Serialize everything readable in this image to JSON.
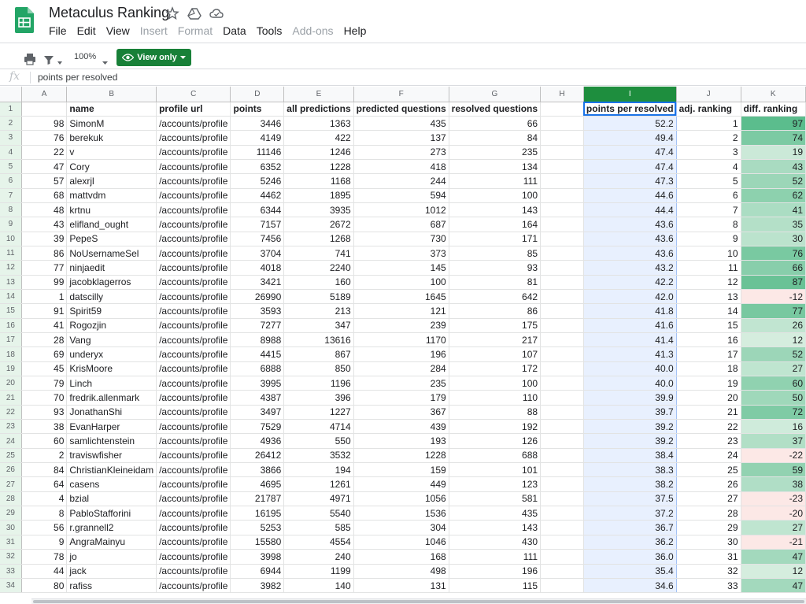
{
  "title": "Metaculus Ranking",
  "menu": [
    {
      "label": "File",
      "disabled": false
    },
    {
      "label": "Edit",
      "disabled": false
    },
    {
      "label": "View",
      "disabled": false
    },
    {
      "label": "Insert",
      "disabled": true
    },
    {
      "label": "Format",
      "disabled": true
    },
    {
      "label": "Data",
      "disabled": false
    },
    {
      "label": "Tools",
      "disabled": false
    },
    {
      "label": "Add-ons",
      "disabled": true
    },
    {
      "label": "Help",
      "disabled": false
    }
  ],
  "toolbar": {
    "zoom": "100%",
    "view_only_label": "View only"
  },
  "formula_bar": {
    "fx_label": "fx",
    "content": "points per resolved"
  },
  "colors": {
    "brand_green": "#188038",
    "selected_col": "#1e8e3e",
    "selected_fill": "#e8f0fe",
    "selection_border": "#1a73e8"
  },
  "columns": [
    "A",
    "B",
    "C",
    "D",
    "E",
    "F",
    "G",
    "H",
    "I",
    "J",
    "K"
  ],
  "selected_column": "I",
  "header_row": {
    "row": "1",
    "cells": [
      "",
      "name",
      "profile url",
      "points",
      "all predictions",
      "predicted questions",
      "resolved questions",
      "",
      "points per resolved",
      "adj. ranking",
      "diff. ranking"
    ]
  },
  "rows": [
    {
      "row": "2",
      "a": "98",
      "name": "SimonM",
      "url": "/accounts/profile",
      "points": "3446",
      "all": "1363",
      "pred": "435",
      "res": "66",
      "h": "",
      "ppr": "52.2",
      "adj": "1",
      "diff": "97"
    },
    {
      "row": "3",
      "a": "76",
      "name": "berekuk",
      "url": "/accounts/profile",
      "points": "4149",
      "all": "422",
      "pred": "137",
      "res": "84",
      "h": "",
      "ppr": "49.4",
      "adj": "2",
      "diff": "74"
    },
    {
      "row": "4",
      "a": "22",
      "name": "v",
      "url": "/accounts/profile",
      "points": "11146",
      "all": "1246",
      "pred": "273",
      "res": "235",
      "h": "",
      "ppr": "47.4",
      "adj": "3",
      "diff": "19"
    },
    {
      "row": "5",
      "a": "47",
      "name": "Cory",
      "url": "/accounts/profile",
      "points": "6352",
      "all": "1228",
      "pred": "418",
      "res": "134",
      "h": "",
      "ppr": "47.4",
      "adj": "4",
      "diff": "43"
    },
    {
      "row": "6",
      "a": "57",
      "name": "alexrjl",
      "url": "/accounts/profile",
      "points": "5246",
      "all": "1168",
      "pred": "244",
      "res": "111",
      "h": "",
      "ppr": "47.3",
      "adj": "5",
      "diff": "52"
    },
    {
      "row": "7",
      "a": "68",
      "name": "mattvdm",
      "url": "/accounts/profile",
      "points": "4462",
      "all": "1895",
      "pred": "594",
      "res": "100",
      "h": "",
      "ppr": "44.6",
      "adj": "6",
      "diff": "62"
    },
    {
      "row": "8",
      "a": "48",
      "name": "krtnu",
      "url": "/accounts/profile",
      "points": "6344",
      "all": "3935",
      "pred": "1012",
      "res": "143",
      "h": "",
      "ppr": "44.4",
      "adj": "7",
      "diff": "41"
    },
    {
      "row": "9",
      "a": "43",
      "name": "elifland_ought",
      "url": "/accounts/profile",
      "points": "7157",
      "all": "2672",
      "pred": "687",
      "res": "164",
      "h": "",
      "ppr": "43.6",
      "adj": "8",
      "diff": "35"
    },
    {
      "row": "10",
      "a": "39",
      "name": "PepeS",
      "url": "/accounts/profile",
      "points": "7456",
      "all": "1268",
      "pred": "730",
      "res": "171",
      "h": "",
      "ppr": "43.6",
      "adj": "9",
      "diff": "30"
    },
    {
      "row": "11",
      "a": "86",
      "name": "NoUsernameSel",
      "url": "/accounts/profile",
      "points": "3704",
      "all": "741",
      "pred": "373",
      "res": "85",
      "h": "",
      "ppr": "43.6",
      "adj": "10",
      "diff": "76"
    },
    {
      "row": "12",
      "a": "77",
      "name": "ninjaedit",
      "url": "/accounts/profile",
      "points": "4018",
      "all": "2240",
      "pred": "145",
      "res": "93",
      "h": "",
      "ppr": "43.2",
      "adj": "11",
      "diff": "66"
    },
    {
      "row": "13",
      "a": "99",
      "name": "jacobklagerros",
      "url": "/accounts/profile",
      "points": "3421",
      "all": "160",
      "pred": "100",
      "res": "81",
      "h": "",
      "ppr": "42.2",
      "adj": "12",
      "diff": "87"
    },
    {
      "row": "14",
      "a": "1",
      "name": "datscilly",
      "url": "/accounts/profile",
      "points": "26990",
      "all": "5189",
      "pred": "1645",
      "res": "642",
      "h": "",
      "ppr": "42.0",
      "adj": "13",
      "diff": "-12"
    },
    {
      "row": "15",
      "a": "91",
      "name": "Spirit59",
      "url": "/accounts/profile",
      "points": "3593",
      "all": "213",
      "pred": "121",
      "res": "86",
      "h": "",
      "ppr": "41.8",
      "adj": "14",
      "diff": "77"
    },
    {
      "row": "16",
      "a": "41",
      "name": "Rogozjin",
      "url": "/accounts/profile",
      "points": "7277",
      "all": "347",
      "pred": "239",
      "res": "175",
      "h": "",
      "ppr": "41.6",
      "adj": "15",
      "diff": "26"
    },
    {
      "row": "17",
      "a": "28",
      "name": "Vang",
      "url": "/accounts/profile",
      "points": "8988",
      "all": "13616",
      "pred": "1170",
      "res": "217",
      "h": "",
      "ppr": "41.4",
      "adj": "16",
      "diff": "12"
    },
    {
      "row": "18",
      "a": "69",
      "name": "underyx",
      "url": "/accounts/profile",
      "points": "4415",
      "all": "867",
      "pred": "196",
      "res": "107",
      "h": "",
      "ppr": "41.3",
      "adj": "17",
      "diff": "52"
    },
    {
      "row": "19",
      "a": "45",
      "name": "KrisMoore",
      "url": "/accounts/profile",
      "points": "6888",
      "all": "850",
      "pred": "284",
      "res": "172",
      "h": "",
      "ppr": "40.0",
      "adj": "18",
      "diff": "27"
    },
    {
      "row": "20",
      "a": "79",
      "name": "Linch",
      "url": "/accounts/profile",
      "points": "3995",
      "all": "1196",
      "pred": "235",
      "res": "100",
      "h": "",
      "ppr": "40.0",
      "adj": "19",
      "diff": "60"
    },
    {
      "row": "21",
      "a": "70",
      "name": "fredrik.allenmark",
      "url": "/accounts/profile",
      "points": "4387",
      "all": "396",
      "pred": "179",
      "res": "110",
      "h": "",
      "ppr": "39.9",
      "adj": "20",
      "diff": "50"
    },
    {
      "row": "22",
      "a": "93",
      "name": "JonathanShi",
      "url": "/accounts/profile",
      "points": "3497",
      "all": "1227",
      "pred": "367",
      "res": "88",
      "h": "",
      "ppr": "39.7",
      "adj": "21",
      "diff": "72"
    },
    {
      "row": "23",
      "a": "38",
      "name": "EvanHarper",
      "url": "/accounts/profile",
      "points": "7529",
      "all": "4714",
      "pred": "439",
      "res": "192",
      "h": "",
      "ppr": "39.2",
      "adj": "22",
      "diff": "16"
    },
    {
      "row": "24",
      "a": "60",
      "name": "samlichtenstein",
      "url": "/accounts/profile",
      "points": "4936",
      "all": "550",
      "pred": "193",
      "res": "126",
      "h": "",
      "ppr": "39.2",
      "adj": "23",
      "diff": "37"
    },
    {
      "row": "25",
      "a": "2",
      "name": "traviswfisher",
      "url": "/accounts/profile",
      "points": "26412",
      "all": "3532",
      "pred": "1228",
      "res": "688",
      "h": "",
      "ppr": "38.4",
      "adj": "24",
      "diff": "-22"
    },
    {
      "row": "26",
      "a": "84",
      "name": "ChristianKleineidam",
      "url": "/accounts/profile",
      "points": "3866",
      "all": "194",
      "pred": "159",
      "res": "101",
      "h": "",
      "ppr": "38.3",
      "adj": "25",
      "diff": "59"
    },
    {
      "row": "27",
      "a": "64",
      "name": "casens",
      "url": "/accounts/profile",
      "points": "4695",
      "all": "1261",
      "pred": "449",
      "res": "123",
      "h": "",
      "ppr": "38.2",
      "adj": "26",
      "diff": "38"
    },
    {
      "row": "28",
      "a": "4",
      "name": "bzial",
      "url": "/accounts/profile",
      "points": "21787",
      "all": "4971",
      "pred": "1056",
      "res": "581",
      "h": "",
      "ppr": "37.5",
      "adj": "27",
      "diff": "-23"
    },
    {
      "row": "29",
      "a": "8",
      "name": "PabloStafforini",
      "url": "/accounts/profile",
      "points": "16195",
      "all": "5540",
      "pred": "1536",
      "res": "435",
      "h": "",
      "ppr": "37.2",
      "adj": "28",
      "diff": "-20"
    },
    {
      "row": "30",
      "a": "56",
      "name": "r.grannell2",
      "url": "/accounts/profile",
      "points": "5253",
      "all": "585",
      "pred": "304",
      "res": "143",
      "h": "",
      "ppr": "36.7",
      "adj": "29",
      "diff": "27"
    },
    {
      "row": "31",
      "a": "9",
      "name": "AngraMainyu",
      "url": "/accounts/profile",
      "points": "15580",
      "all": "4554",
      "pred": "1046",
      "res": "430",
      "h": "",
      "ppr": "36.2",
      "adj": "30",
      "diff": "-21"
    },
    {
      "row": "32",
      "a": "78",
      "name": "jo",
      "url": "/accounts/profile",
      "points": "3998",
      "all": "240",
      "pred": "168",
      "res": "111",
      "h": "",
      "ppr": "36.0",
      "adj": "31",
      "diff": "47"
    },
    {
      "row": "33",
      "a": "44",
      "name": "jack",
      "url": "/accounts/profile",
      "points": "6944",
      "all": "1199",
      "pred": "498",
      "res": "196",
      "h": "",
      "ppr": "35.4",
      "adj": "32",
      "diff": "12"
    },
    {
      "row": "34",
      "a": "80",
      "name": "rafiss",
      "url": "/accounts/profile",
      "points": "3982",
      "all": "140",
      "pred": "131",
      "res": "115",
      "h": "",
      "ppr": "34.6",
      "adj": "33",
      "diff": "47"
    }
  ]
}
